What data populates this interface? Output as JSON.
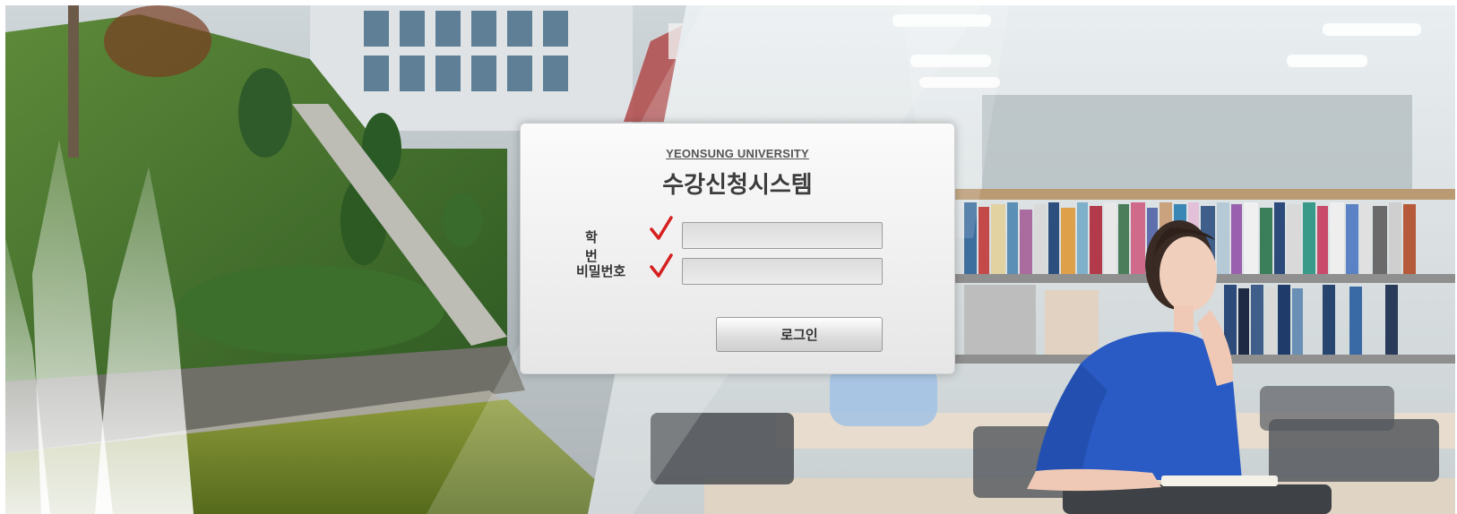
{
  "header": {
    "university": "YEONSUNG UNIVERSITY",
    "system_title": "수강신청시스템"
  },
  "form": {
    "student_id_label": "학 번",
    "password_label": "비밀번호",
    "student_id_value": "",
    "password_value": "",
    "login_label": "로그인"
  },
  "colors": {
    "checkmark": "#d61f1f",
    "panel": "#efefef"
  },
  "icons": {
    "check_mark": "check-icon"
  }
}
